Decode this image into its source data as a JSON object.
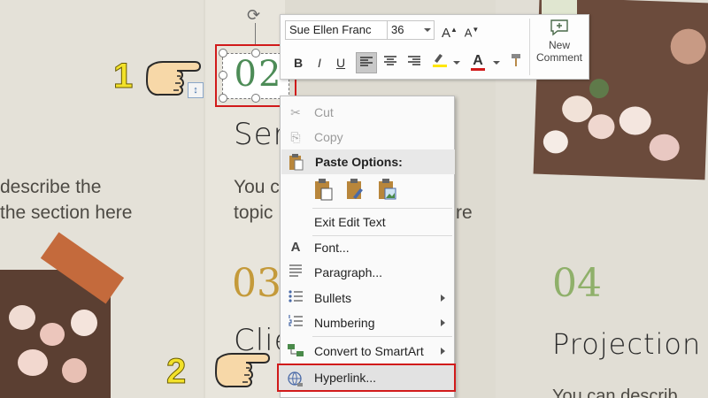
{
  "slide": {
    "left_text_line1": "describe the",
    "left_text_line2": "the section here",
    "mid_title": "Servi",
    "mid_text_line1": "You c",
    "mid_text_line2": "topic",
    "mid_text_suffix": "re",
    "num_03": "03",
    "clien_title": "Clien",
    "num_04": "04",
    "projection_title": "Projection",
    "bottom_right_text": "You can describ"
  },
  "textbox": {
    "value": "02"
  },
  "mini_toolbar": {
    "font_name": "Sue Ellen Franc",
    "font_size": "36",
    "grow_label": "A",
    "shrink_label": "A",
    "bold": "B",
    "italic": "I",
    "underline": "U",
    "new_comment": "New\nComment",
    "font_color": "#d11a1a",
    "highlight_color": "#ffe600"
  },
  "context_menu": {
    "cut": "Cut",
    "copy": "Copy",
    "paste_options": "Paste Options:",
    "exit_edit_text": "Exit Edit Text",
    "font": "Font...",
    "paragraph": "Paragraph...",
    "bullets": "Bullets",
    "numbering": "Numbering",
    "convert_smartart": "Convert to SmartArt",
    "hyperlink": "Hyperlink..."
  },
  "steps": {
    "step1": "1",
    "step2": "2"
  },
  "colors": {
    "highlight_border": "#d11a1a",
    "step_number": "#f2e12a",
    "green_number": "#4d8c57",
    "gold_number": "#c49a3a"
  }
}
